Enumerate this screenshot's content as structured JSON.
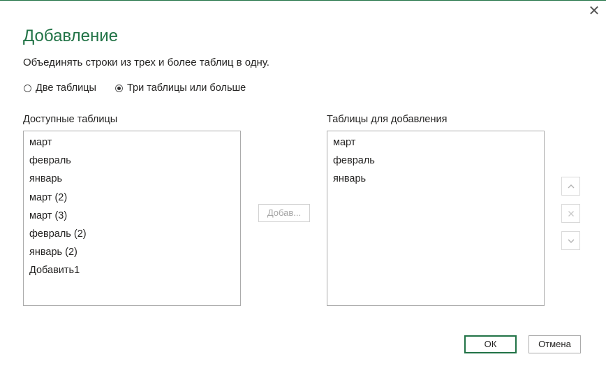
{
  "dialog": {
    "title": "Добавление",
    "subtitle": "Объединять строки из трех и более таблиц в одну.",
    "close_glyph": "✕"
  },
  "mode": {
    "options": [
      {
        "label": "Две таблицы",
        "selected": false
      },
      {
        "label": "Три таблицы или больше",
        "selected": true
      }
    ]
  },
  "available": {
    "label": "Доступные таблицы",
    "items": [
      "март",
      "февраль",
      "январь",
      "март (2)",
      "март (3)",
      "февраль (2)",
      "январь (2)",
      "Добавить1"
    ]
  },
  "add_button": {
    "label": "Добав...",
    "enabled": false
  },
  "selected": {
    "label": "Таблицы для добавления",
    "items": [
      "март",
      "февраль",
      "январь"
    ]
  },
  "footer": {
    "ok_label": "ОК",
    "cancel_label": "Отмена"
  },
  "colors": {
    "accent": "#217346",
    "disabled": "#a6a6a6",
    "border": "#ababab"
  }
}
